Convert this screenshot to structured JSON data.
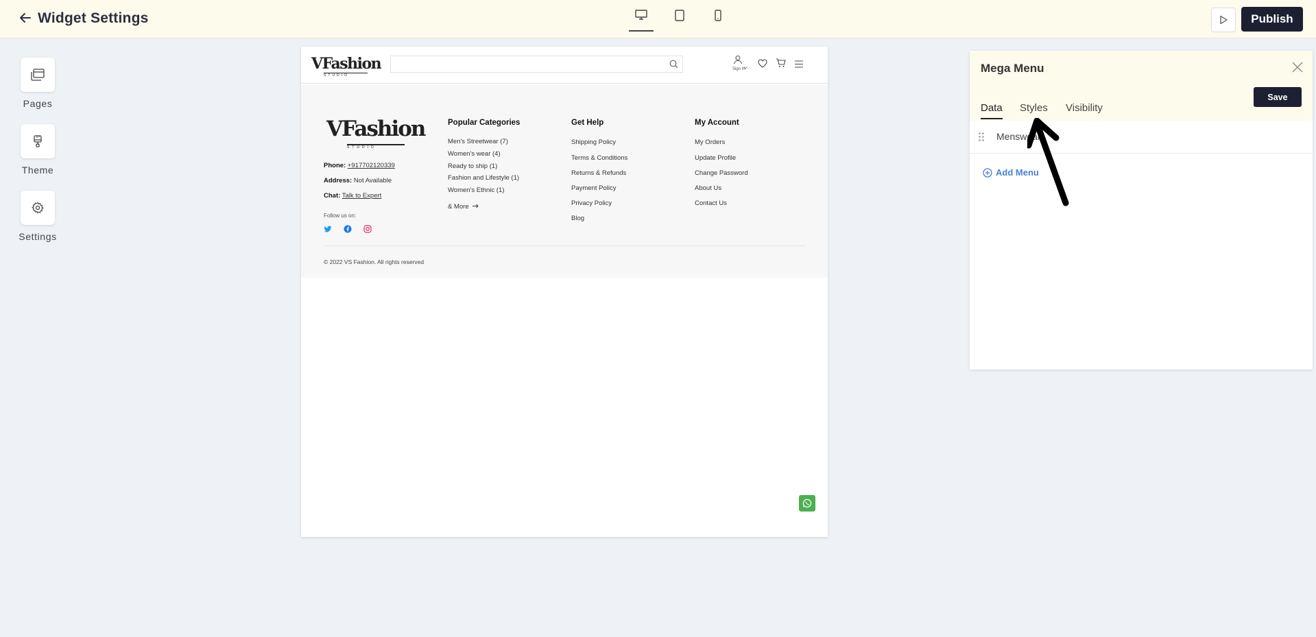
{
  "topbar": {
    "title": "Widget Settings",
    "publish_label": "Publish"
  },
  "rail": [
    {
      "label": "Pages"
    },
    {
      "label": "Theme"
    },
    {
      "label": "Settings"
    }
  ],
  "site": {
    "logo_text": "VFashion",
    "logo_sub": "STUDIO",
    "signin_label": "Sign In",
    "phone_label": "Phone:",
    "phone_value": "+917702120339",
    "address_label": "Address:",
    "address_value": "Not Available",
    "chat_label": "Chat:",
    "chat_value": "Talk to Expert",
    "follow_label": "Follow us on:",
    "columns": [
      {
        "title": "Popular Categories",
        "links": [
          "Men's Streetwear (7)",
          "Women's wear (4)",
          "Ready to ship (1)",
          "Fashion and Lifestyle (1)",
          "Women's Ethnic (1)"
        ],
        "more": "& More"
      },
      {
        "title": "Get Help",
        "links": [
          "Shipping Policy",
          "Terms & Conditions",
          "Returns & Refunds",
          "Payment Policy",
          "Privacy Policy",
          "Blog"
        ]
      },
      {
        "title": "My Account",
        "links": [
          "My Orders",
          "Update Profile",
          "Change Password",
          "About Us",
          "Contact Us"
        ]
      }
    ],
    "copyright": "© 2022 VS Fashion. All rights reserved"
  },
  "panel": {
    "title": "Mega Menu",
    "save_label": "Save",
    "tabs": [
      "Data",
      "Styles",
      "Visibility"
    ],
    "menu_item": "Menswear",
    "add_menu": "Add Menu"
  },
  "colors": {
    "topbar_bg": "#fdfbec",
    "dark_button": "#1d1f33",
    "link_blue": "#4a7fd6",
    "whatsapp_green": "#4caf50"
  }
}
